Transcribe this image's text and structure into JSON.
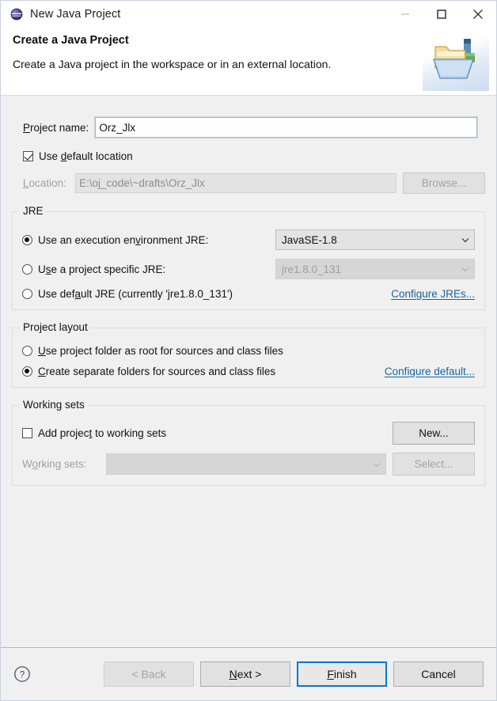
{
  "window": {
    "title": "New Java Project",
    "icon": "java-project-icon",
    "controls": {
      "minimize": "minimize-icon",
      "maximize": "maximize-icon",
      "close": "close-icon"
    },
    "minimize_enabled": false
  },
  "header": {
    "title": "Create a Java Project",
    "description": "Create a Java project in the workspace or in an external location.",
    "icon": "new-java-project-folder-icon"
  },
  "project": {
    "name_label": "Project name:",
    "name_value": "Orz_Jlx",
    "name_placeholder": "",
    "use_default_location_label": "Use default location",
    "use_default_location_checked": true,
    "location_label": "Location:",
    "location_value": "E:\\oj_code\\~drafts\\Orz_Jlx",
    "browse_label": "Browse...",
    "browse_enabled": false
  },
  "jre": {
    "group_label": "JRE",
    "options": [
      {
        "label": "Use an execution environment JRE:",
        "selected": true
      },
      {
        "label": "Use a project specific JRE:",
        "selected": false
      },
      {
        "label": "Use default JRE (currently 'jre1.8.0_131')",
        "selected": false
      }
    ],
    "execution_env_value": "JavaSE-1.8",
    "specific_jre_value": "jre1.8.0_131",
    "specific_jre_enabled": false,
    "configure_link": "Configure JREs..."
  },
  "layout": {
    "group_label": "Project layout",
    "options": [
      {
        "label": "Use project folder as root for sources and class files",
        "selected": false
      },
      {
        "label": "Create separate folders for sources and class files",
        "selected": true
      }
    ],
    "configure_link": "Configure default..."
  },
  "working_sets": {
    "group_label": "Working sets",
    "add_label": "Add project to working sets",
    "add_checked": false,
    "new_label": "New...",
    "sets_label": "Working sets:",
    "sets_value": "",
    "sets_enabled": false,
    "select_label": "Select...",
    "select_enabled": false
  },
  "footer": {
    "help_icon": "help-icon",
    "back_label": "< Back",
    "back_enabled": false,
    "next_label": "Next >",
    "finish_label": "Finish",
    "cancel_label": "Cancel",
    "default_button": "Finish"
  },
  "colors": {
    "accent": "#0078d7",
    "link": "#1464a0",
    "dialog_bg": "#f0f0f0",
    "field_bg": "#ffffff",
    "disabled_text": "#a0a0a0"
  }
}
